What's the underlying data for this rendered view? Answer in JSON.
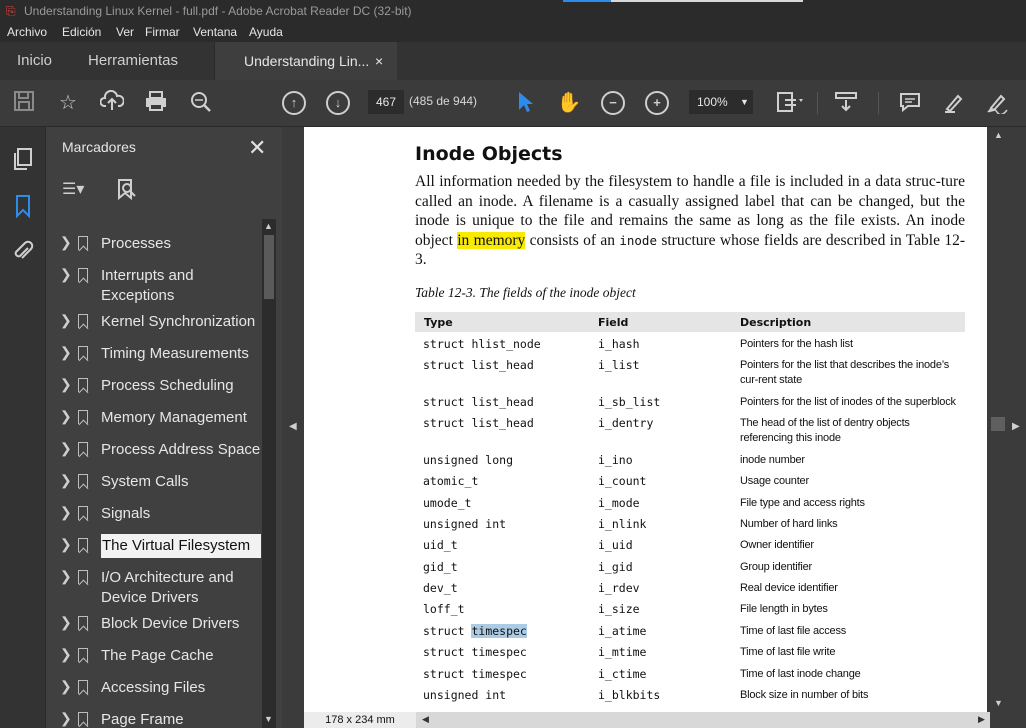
{
  "window": {
    "title": "Understanding Linux Kernel - full.pdf - Adobe Acrobat Reader DC (32-bit)"
  },
  "menu": [
    "Archivo",
    "Edición",
    "Ver",
    "Firmar",
    "Ventana",
    "Ayuda"
  ],
  "tabs": {
    "home": "Inicio",
    "tools": "Herramientas",
    "document": "Understanding Lin...",
    "close": "×"
  },
  "toolbar": {
    "page_current": "467",
    "page_count": "(485 de 944)",
    "zoom": "100%",
    "icons": [
      "save-icon",
      "star-icon",
      "upload-icon",
      "print-icon",
      "search-zoom-icon",
      "arrow-up-icon",
      "arrow-down-icon",
      "cursor-icon",
      "hand-icon",
      "zoom-out-icon",
      "zoom-in-icon",
      "page-fit-icon",
      "scroll-mode-icon",
      "comment-icon",
      "highlight-pen-icon",
      "sign-icon"
    ]
  },
  "bookmarks_panel": {
    "title": "Marcadores",
    "close": "✕",
    "items": [
      {
        "label": "Processes"
      },
      {
        "label": "Interrupts and Exceptions"
      },
      {
        "label": "Kernel Synchronization"
      },
      {
        "label": "Timing Measurements"
      },
      {
        "label": "Process Scheduling"
      },
      {
        "label": "Memory Management"
      },
      {
        "label": "Process Address Space"
      },
      {
        "label": "System Calls"
      },
      {
        "label": "Signals"
      },
      {
        "label": "The Virtual Filesystem",
        "selected": true
      },
      {
        "label": "I/O Architecture and Device Drivers"
      },
      {
        "label": "Block Device Drivers"
      },
      {
        "label": "The Page Cache"
      },
      {
        "label": "Accessing Files"
      },
      {
        "label": "Page Frame Reclaiming"
      }
    ]
  },
  "document": {
    "heading": "Inode Objects",
    "para_a": "All information needed by the filesystem to handle a file is included in a data struc-ture called an inode. A filename is a casually assigned label that can be changed, but the inode is unique to the file and remains the same as long as the file exists. An inode object ",
    "para_highlight": "in memory",
    "para_b": " consists of an ",
    "para_code": "inode",
    "para_c": " structure whose fields are described in Table 12-3.",
    "caption": "Table 12-3. The fields of the inode object",
    "columns": [
      "Type",
      "Field",
      "Description"
    ],
    "rows": [
      {
        "type": "struct hlist_node",
        "field": "i_hash",
        "desc": "Pointers for the hash list"
      },
      {
        "type": "struct list_head",
        "field": "i_list",
        "desc": "Pointers for the list that describes the inode’s cur-rent state"
      },
      {
        "type": "struct list_head",
        "field": "i_sb_list",
        "desc": "Pointers for the list of inodes of the superblock"
      },
      {
        "type": "struct list_head",
        "field": "i_dentry",
        "desc": "The head of the list of dentry objects referencing this inode"
      },
      {
        "type": "unsigned long",
        "field": "i_ino",
        "desc": "inode number"
      },
      {
        "type": "atomic_t",
        "field": "i_count",
        "desc": "Usage counter"
      },
      {
        "type": "umode_t",
        "field": "i_mode",
        "desc": "File type and access rights"
      },
      {
        "type": "unsigned int",
        "field": "i_nlink",
        "desc": "Number of hard links"
      },
      {
        "type": "uid_t",
        "field": "i_uid",
        "desc": "Owner identifier"
      },
      {
        "type": "gid_t",
        "field": "i_gid",
        "desc": "Group identifier"
      },
      {
        "type": "dev_t",
        "field": "i_rdev",
        "desc": "Real device identifier"
      },
      {
        "type": "loff_t",
        "field": "i_size",
        "desc": "File length in bytes"
      },
      {
        "type_a": "struct ",
        "type_sel": "timespec",
        "field": "i_atime",
        "desc": "Time of last file access"
      },
      {
        "type": "struct timespec",
        "field": "i_mtime",
        "desc": "Time of last file write"
      },
      {
        "type": "struct timespec",
        "field": "i_ctime",
        "desc": "Time of last inode change"
      },
      {
        "type": "unsigned int",
        "field": "i_blkbits",
        "desc": "Block size in number of bits"
      }
    ]
  },
  "status": {
    "page_size": "178 x 234 mm"
  }
}
